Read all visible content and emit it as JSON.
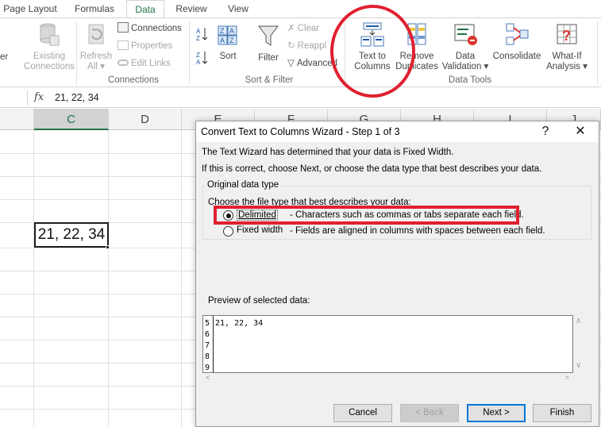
{
  "tabs": [
    {
      "label": "Page Layout"
    },
    {
      "label": "Formulas"
    },
    {
      "label": "Data"
    },
    {
      "label": "Review"
    },
    {
      "label": "View"
    }
  ],
  "ribbon": {
    "partial_left": "er",
    "existing_connections": {
      "line1": "Existing",
      "line2": "Connections"
    },
    "refresh_all": {
      "line1": "Refresh",
      "line2": "All ▾"
    },
    "connections": "Connections",
    "properties": "Properties",
    "edit_links": "Edit Links",
    "group_connections": "Connections",
    "sort_az": "A↓Z",
    "sort": "Sort",
    "filter": "Filter",
    "clear": "Clear",
    "reapply": "Reappl",
    "advanced": "Advanced",
    "group_sort_filter": "Sort & Filter",
    "text_to_columns": {
      "line1": "Text to",
      "line2": "Columns"
    },
    "remove_duplicates": {
      "line1": "Remove",
      "line2": "Duplicates"
    },
    "data_validation": {
      "line1": "Data",
      "line2": "Validation ▾"
    },
    "consolidate": "Consolidate",
    "what_if": {
      "line1": "What-If",
      "line2": "Analysis ▾"
    },
    "group_data_tools": "Data Tools"
  },
  "formula_bar": {
    "fx": "fx",
    "value": "21, 22, 34"
  },
  "sheet": {
    "columns": [
      "C",
      "D",
      "E",
      "F",
      "G",
      "H",
      "I",
      "J"
    ],
    "active_cell_value": "21, 22, 34"
  },
  "dialog": {
    "title": "Convert Text to Columns Wizard - Step 1 of 3",
    "help": "?",
    "close": "✕",
    "line1": "The Text Wizard has determined that your data is Fixed Width.",
    "line2": "If this is correct, choose Next, or choose the data type that best describes your data.",
    "group_label": "Original data type",
    "choose_label": "Choose the file type that best describes your data:",
    "options": [
      {
        "label": "Delimited",
        "desc": "- Characters such as commas or tabs separate each field.",
        "selected": true
      },
      {
        "label": "Fixed width",
        "desc": "- Fields are aligned in columns with spaces between each field.",
        "selected": false
      }
    ],
    "preview_label": "Preview of selected data:",
    "preview_rows": [
      {
        "num": "5",
        "text": "21, 22, 34"
      },
      {
        "num": "6",
        "text": ""
      },
      {
        "num": "7",
        "text": ""
      },
      {
        "num": "8",
        "text": ""
      },
      {
        "num": "9",
        "text": ""
      }
    ],
    "buttons": {
      "cancel": "Cancel",
      "back": "< Back",
      "next": "Next >",
      "finish": "Finish"
    }
  },
  "colors": {
    "accent": "#217346",
    "annotation": "#e0202f",
    "focus": "#0078d7"
  }
}
